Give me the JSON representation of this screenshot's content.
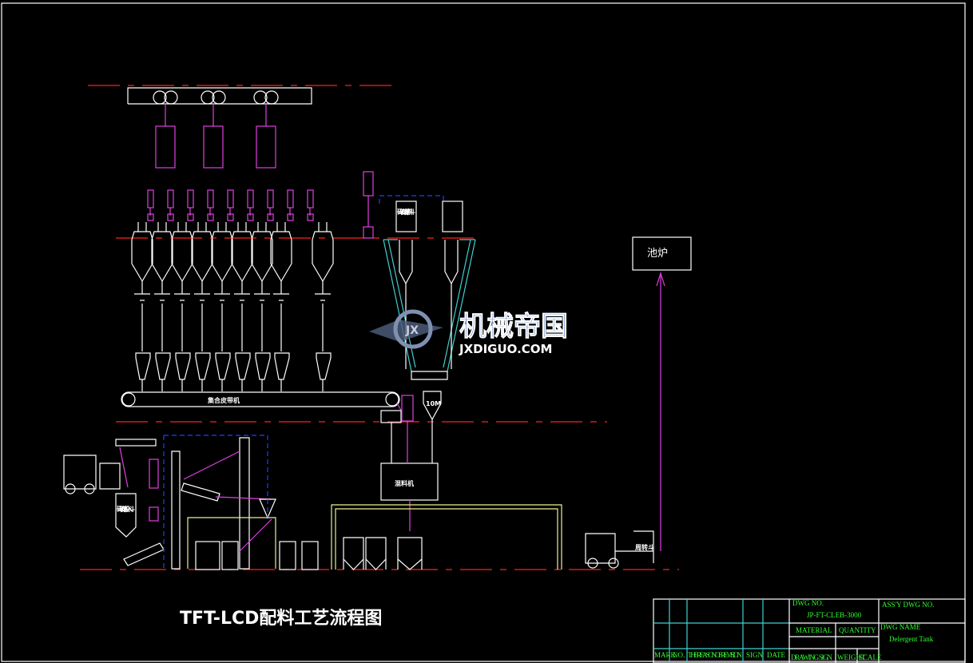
{
  "drawing": {
    "title": "TFT-LCD配料工艺流程图",
    "furnace_label": "池炉",
    "mixer_label": "混料机",
    "belt_label": "集合皮带机",
    "cullet_storage_label": "碎玻璃储料斗",
    "cullet_input_label": "碎玻璃投入斗",
    "silo_volume_label": "10M",
    "bin_label": "周转斗",
    "watermark": {
      "text": "机械帝国",
      "subtext": "JXDIGUO.COM"
    }
  },
  "title_block": {
    "dwg_no_label": "DWG NO.",
    "dwg_no": "JP-FT-CLEB-3000",
    "assy_dwg_no_label": "ASS'Y DWG NO.",
    "material_label": "MATERIAL",
    "quantity_label": "QUANTITY",
    "dwg_name_label": "DWG NAME",
    "dwg_name": "Delergent Tank",
    "mark_label": "MARK",
    "no_label": "NO.",
    "reason_label": "THE REASON OF REVISION",
    "sign_label": "SIGN",
    "date_label": "DATE",
    "drawing_sign_label": "DRAWING SIGN",
    "weight_label": "WEIGHT",
    "scale_label": "SCALE"
  },
  "colors": {
    "background": "#000000",
    "line": "#ffffff",
    "dust_collector": "#e040e0",
    "centerline": "#ff2020",
    "duct": "#40d0d0",
    "conveyor": "#f0f090",
    "title_block_text": "#30ff30"
  }
}
